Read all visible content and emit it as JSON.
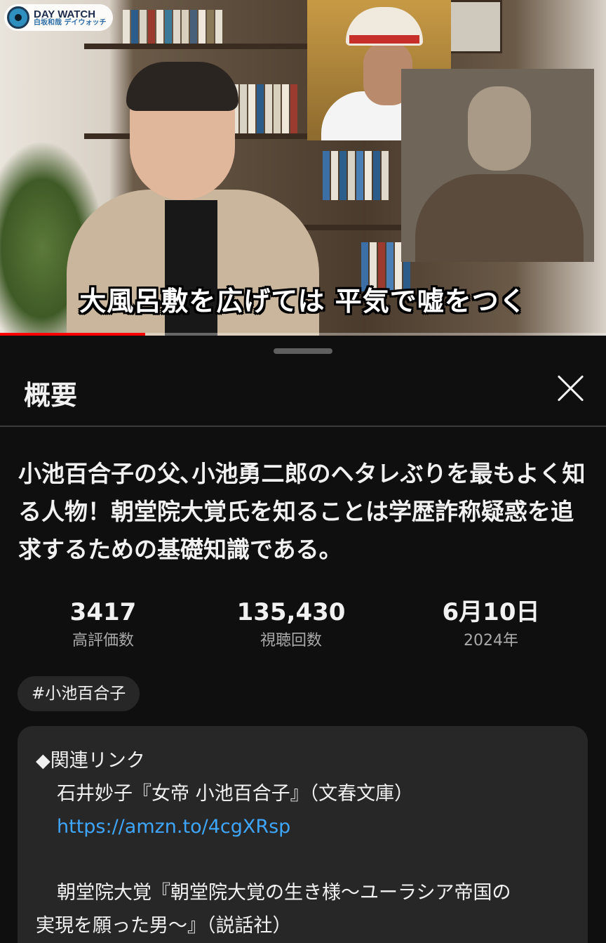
{
  "video": {
    "channel_logo_line1": "DAY WATCH",
    "channel_logo_line2": "白坂和哉 デイウォッチ",
    "caption": "大風呂敷を広げては 平気で嘘をつく",
    "progress_fraction": 0.24
  },
  "sheet": {
    "title": "概要",
    "video_title": "小池百合子の父､小池勇二郎のヘタレぶりを最もよく知る人物！朝堂院大覚氏を知ることは学歴詐称疑惑を追求するための基礎知識である。",
    "stats": [
      {
        "value": "3417",
        "label": "高評価数"
      },
      {
        "value": "135,430",
        "label": "視聴回数"
      },
      {
        "value": "6月10日",
        "label": "2024年"
      }
    ],
    "hashtag": "#小池百合子",
    "description": {
      "heading": "◆関連リンク",
      "book1": "石井妙子『女帝 小池百合子』（文春文庫）",
      "link1": "https://amzn.to/4cgXRsp",
      "book2_line1": "朝堂院大覚『朝堂院大覚の生き様〜ユーラシア帝国の",
      "book2_line2": "実現を願った男〜』（説話社）"
    }
  }
}
